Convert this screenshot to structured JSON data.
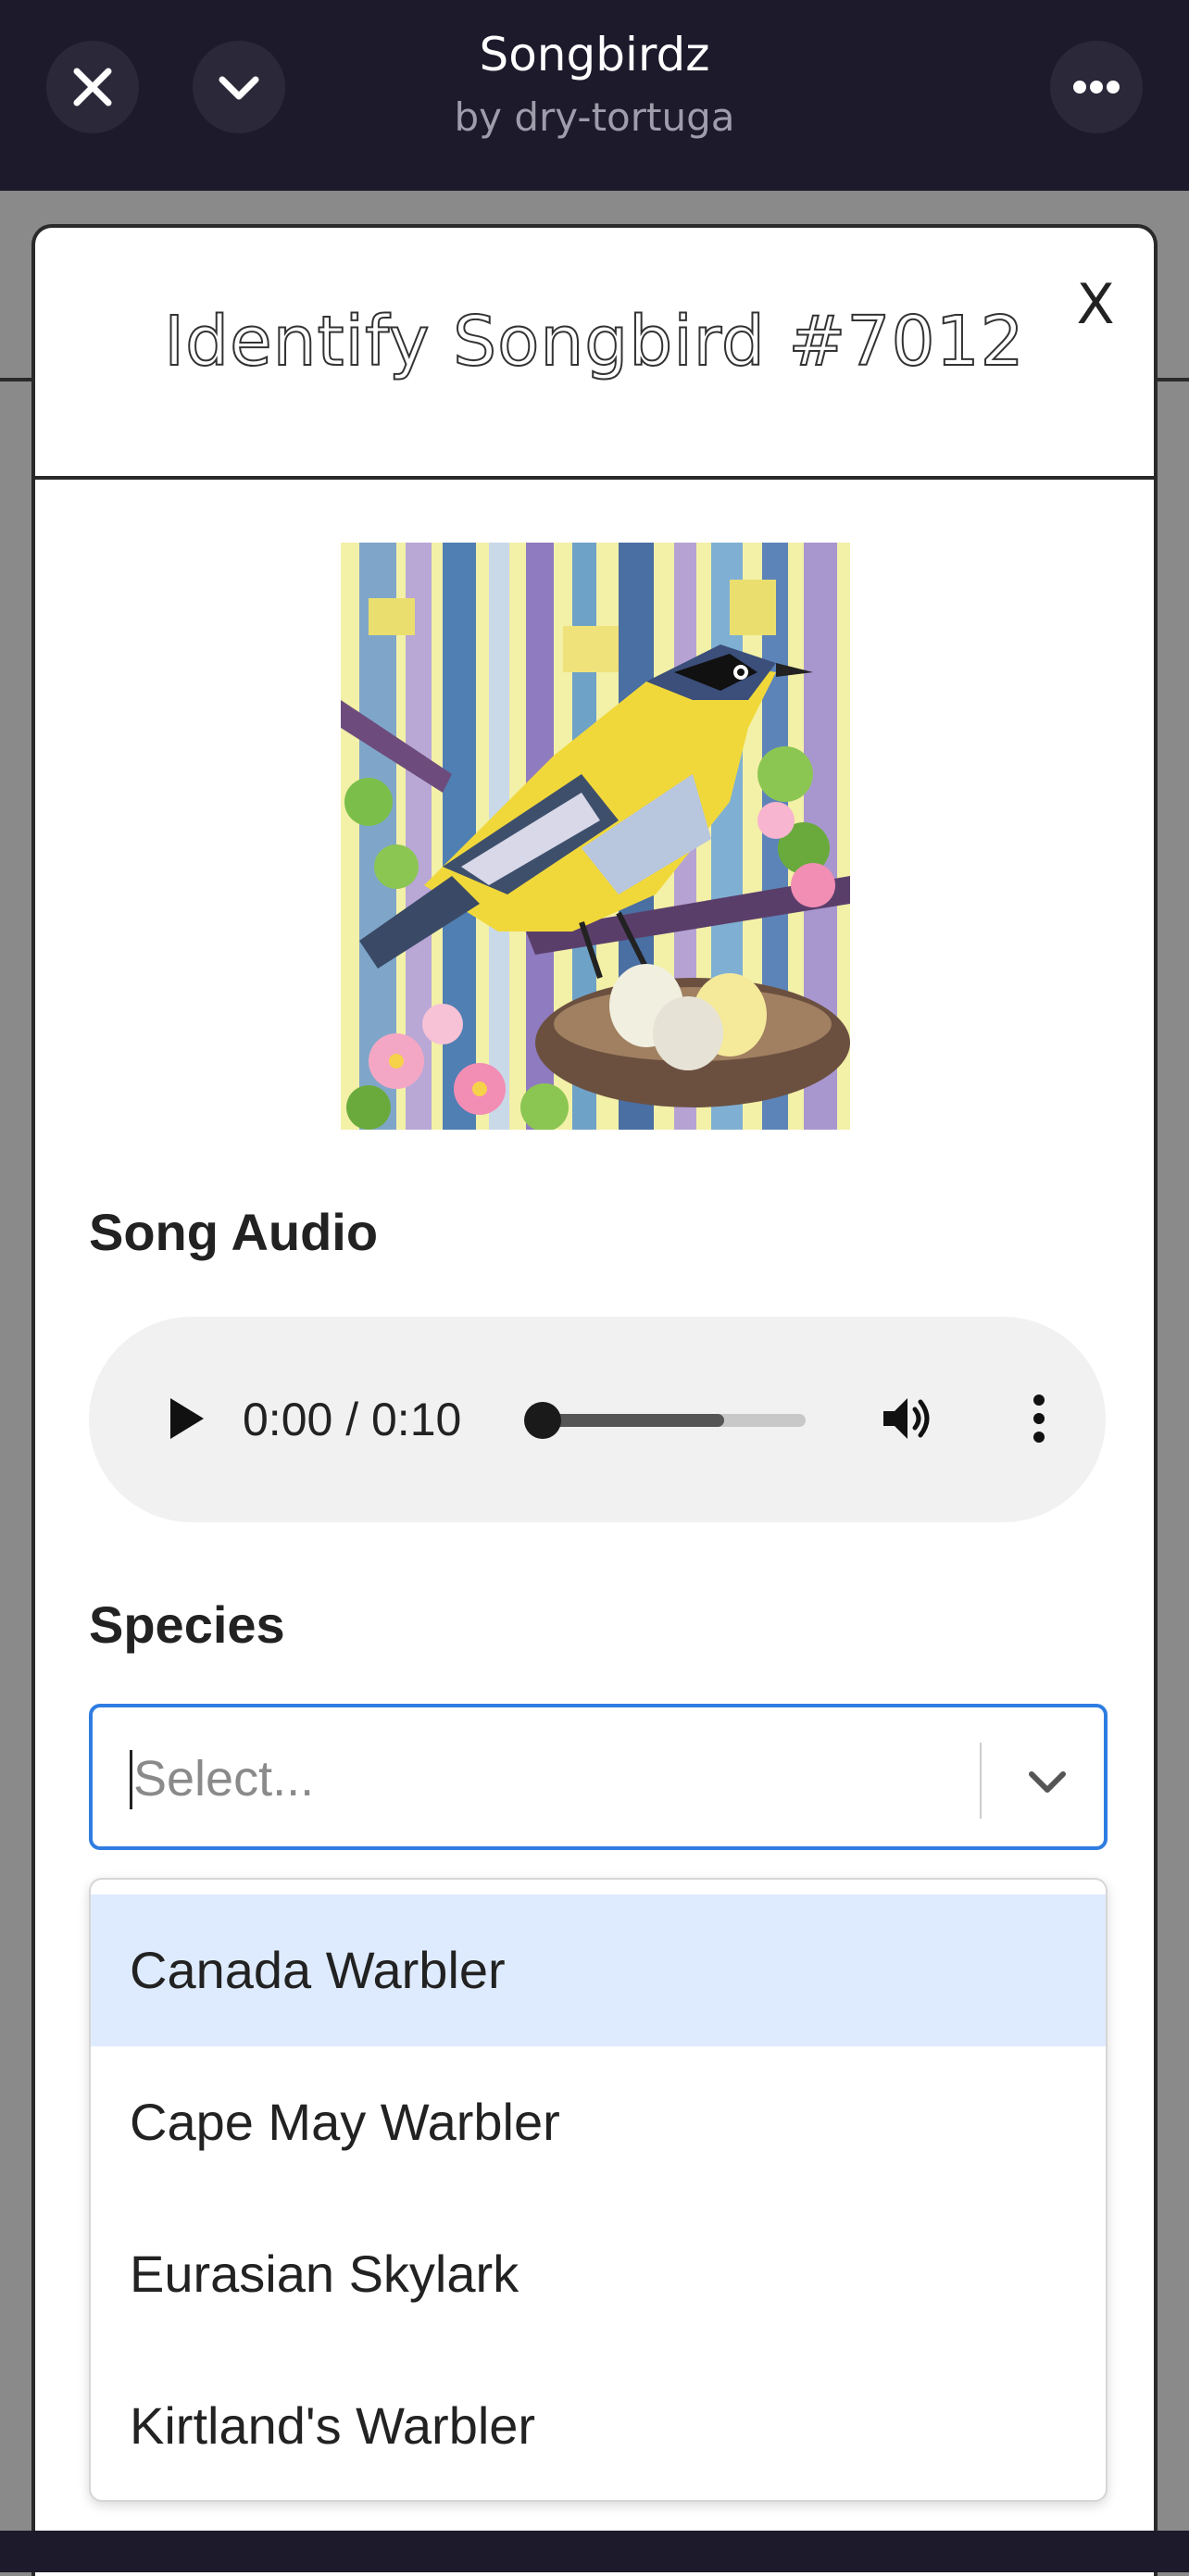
{
  "app_bar": {
    "title": "Songbirdz",
    "subtitle": "by dry-tortuga",
    "close_icon": "close-icon",
    "collapse_icon": "chevron-down-icon",
    "more_icon": "more-horizontal-icon"
  },
  "modal": {
    "title": "Identify Songbird #7012",
    "close_label": "X",
    "image_icon": "songbird-artwork-image"
  },
  "audio": {
    "section_label": "Song Audio",
    "time": "0:00 / 0:10",
    "progress_fraction": 0.0,
    "buffered_fraction": 0.7,
    "play_icon": "play-icon",
    "volume_icon": "volume-icon",
    "menu_icon": "more-vertical-icon"
  },
  "species": {
    "section_label": "Species",
    "placeholder": "Select...",
    "chevron_icon": "chevron-down-icon",
    "options": [
      {
        "label": "Canada Warbler",
        "highlighted": true
      },
      {
        "label": "Cape May Warbler",
        "highlighted": false
      },
      {
        "label": "Eurasian Skylark",
        "highlighted": false
      },
      {
        "label": "Kirtland's Warbler",
        "highlighted": false
      }
    ]
  },
  "colors": {
    "app_bar": "#1c1a2b",
    "focus_border": "#2f7de1",
    "highlight": "#deebff"
  }
}
